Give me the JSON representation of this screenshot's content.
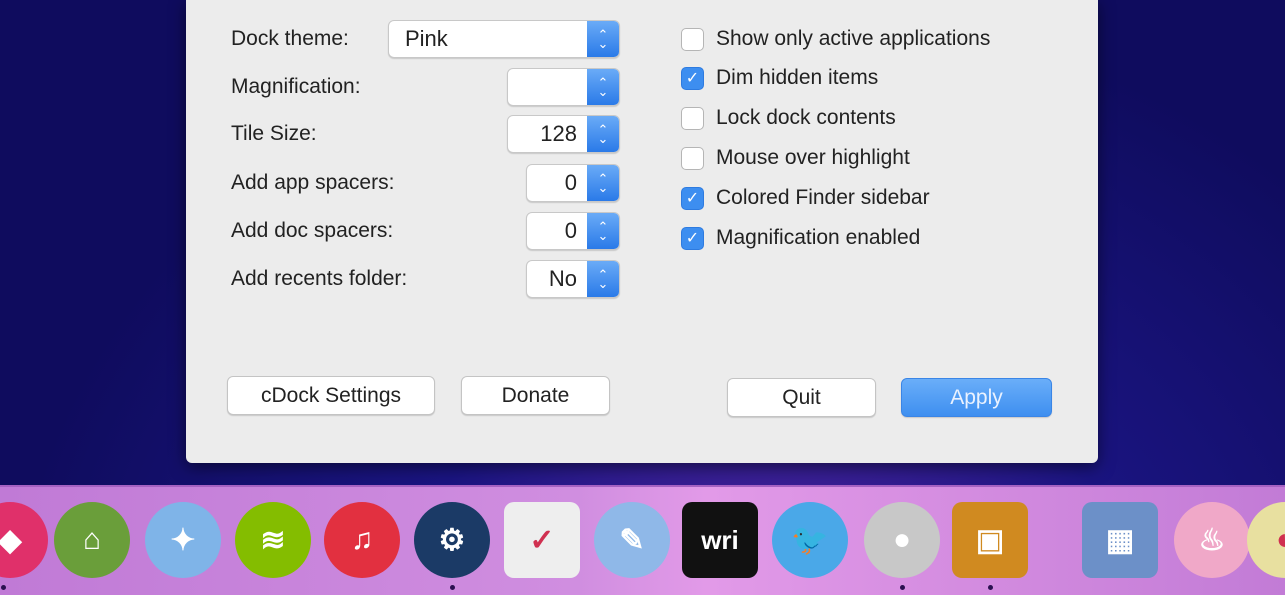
{
  "settings": {
    "rows": [
      {
        "label": "Dock theme:",
        "value": "Pink"
      },
      {
        "label": "Magnification:",
        "value": ""
      },
      {
        "label": "Tile Size:",
        "value": "128"
      },
      {
        "label": "Add app spacers:",
        "value": "0"
      },
      {
        "label": "Add doc spacers:",
        "value": "0"
      },
      {
        "label": "Add recents folder:",
        "value": "No"
      }
    ],
    "checkboxes": [
      {
        "label": "Show only active applications",
        "checked": false
      },
      {
        "label": "Dim hidden items",
        "checked": true
      },
      {
        "label": "Lock dock contents",
        "checked": false
      },
      {
        "label": "Mouse over highlight",
        "checked": false
      },
      {
        "label": "Colored Finder sidebar",
        "checked": true
      },
      {
        "label": "Magnification enabled",
        "checked": true
      }
    ],
    "buttons": {
      "settings": "cDock Settings",
      "donate": "Donate",
      "quit": "Quit",
      "apply": "Apply"
    }
  },
  "dock": {
    "icons": [
      {
        "name": "kiss-app-icon",
        "color": "#e0306a",
        "glyph": "◆"
      },
      {
        "name": "picasa-icon",
        "color": "#6a9e3a",
        "glyph": "⌂"
      },
      {
        "name": "fish-app-icon",
        "color": "#7fb4e8",
        "glyph": "✦"
      },
      {
        "name": "spotify-icon",
        "color": "#84bd00",
        "glyph": "≋"
      },
      {
        "name": "itunes-icon",
        "color": "#e23040",
        "glyph": "♫"
      },
      {
        "name": "steam-icon",
        "color": "#1b3a66",
        "glyph": "⚙"
      },
      {
        "name": "pocket-icon",
        "color": "#eeeeee",
        "glyph": "✓"
      },
      {
        "name": "textedit-icon",
        "color": "#8fb8e8",
        "glyph": "✎"
      },
      {
        "name": "writer-icon",
        "color": "#111111",
        "glyph": "wri"
      },
      {
        "name": "twitter-icon",
        "color": "#4aa8e8",
        "glyph": "🐦"
      },
      {
        "name": "photo-booth-icon",
        "color": "#c8c8c8",
        "glyph": "●"
      },
      {
        "name": "iphoto-icon",
        "color": "#d08a20",
        "glyph": "▣"
      },
      {
        "name": "virtualbox-icon",
        "color": "#6c90c8",
        "glyph": "▦"
      },
      {
        "name": "cupcake-icon",
        "color": "#f0a8c8",
        "glyph": "♨"
      },
      {
        "name": "app-icon",
        "color": "#e8e0a0",
        "glyph": "◐"
      }
    ]
  }
}
